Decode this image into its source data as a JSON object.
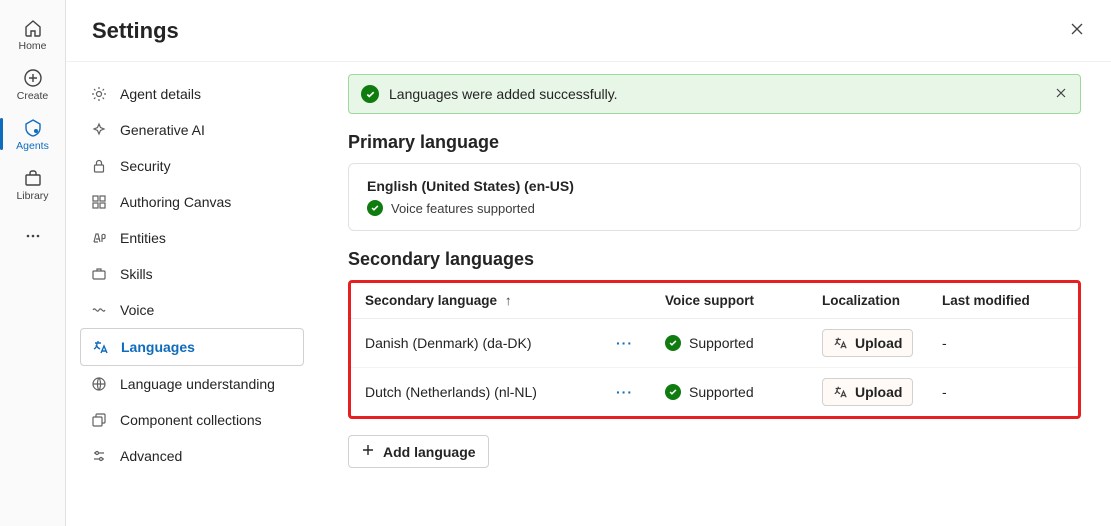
{
  "rail": {
    "items": [
      {
        "label": "Home",
        "icon": "home",
        "selected": false
      },
      {
        "label": "Create",
        "icon": "plus-circle",
        "selected": false
      },
      {
        "label": "Agents",
        "icon": "agent",
        "selected": true
      },
      {
        "label": "Library",
        "icon": "library",
        "selected": false
      }
    ]
  },
  "header": {
    "title": "Settings"
  },
  "settings_nav": {
    "items": [
      {
        "label": "Agent details",
        "icon": "gear"
      },
      {
        "label": "Generative AI",
        "icon": "sparkle"
      },
      {
        "label": "Security",
        "icon": "lock"
      },
      {
        "label": "Authoring Canvas",
        "icon": "grid"
      },
      {
        "label": "Entities",
        "icon": "entity"
      },
      {
        "label": "Skills",
        "icon": "briefcase"
      },
      {
        "label": "Voice",
        "icon": "wave"
      },
      {
        "label": "Languages",
        "icon": "translate",
        "active": true
      },
      {
        "label": "Language understanding",
        "icon": "globe"
      },
      {
        "label": "Component collections",
        "icon": "collection"
      },
      {
        "label": "Advanced",
        "icon": "sliders"
      }
    ]
  },
  "alert": {
    "message": "Languages were added successfully."
  },
  "primary": {
    "heading": "Primary language",
    "name": "English (United States) (en-US)",
    "voice_status": "Voice features supported"
  },
  "secondary": {
    "heading": "Secondary languages",
    "columns": {
      "lang": "Secondary language",
      "voice": "Voice support",
      "loc": "Localization",
      "mod": "Last modified"
    },
    "sort_indicator": "↑",
    "rows": [
      {
        "lang": "Danish (Denmark) (da-DK)",
        "voice": "Supported",
        "loc_action": "Upload",
        "modified": "-"
      },
      {
        "lang": "Dutch (Netherlands) (nl-NL)",
        "voice": "Supported",
        "loc_action": "Upload",
        "modified": "-"
      }
    ],
    "add_button": "Add language"
  }
}
